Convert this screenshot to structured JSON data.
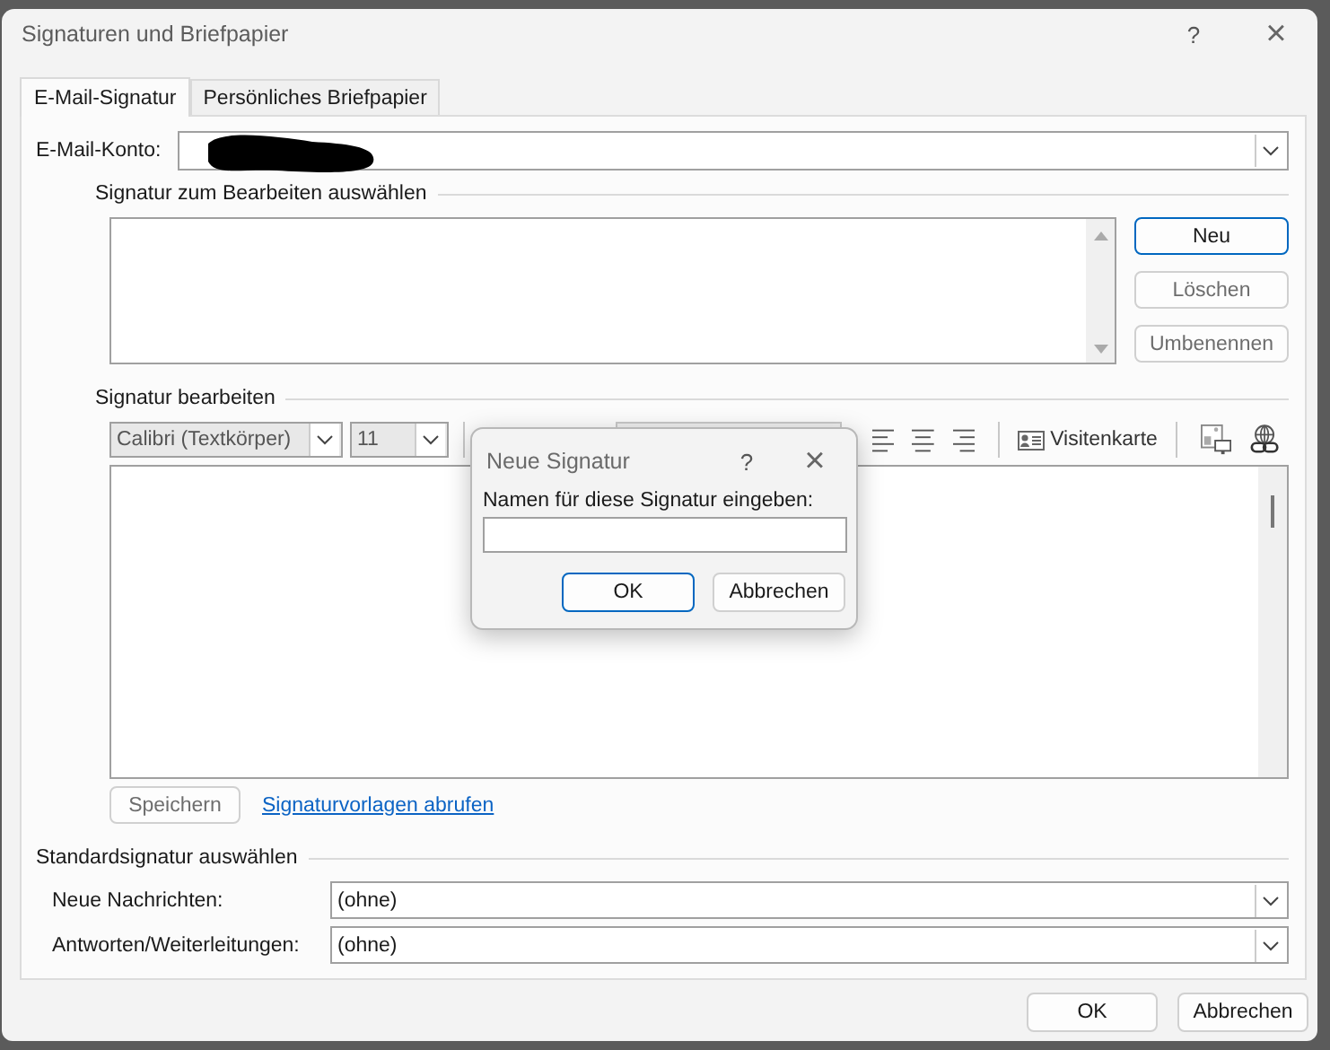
{
  "window": {
    "title": "Signaturen und Briefpapier",
    "help": "?",
    "close": "×"
  },
  "tabs": [
    {
      "label": "E-Mail-Signatur",
      "selected": true
    },
    {
      "label": "Persönliches Briefpapier",
      "selected": false
    }
  ],
  "account": {
    "label": "E-Mail-Konto:"
  },
  "select_group": {
    "title": "Signatur zum Bearbeiten auswählen",
    "buttons": [
      {
        "label": "Neu",
        "default": true,
        "disabled": false
      },
      {
        "label": "Löschen",
        "default": false,
        "disabled": true
      },
      {
        "label": "Umbenennen",
        "default": false,
        "disabled": true
      }
    ]
  },
  "edit_group": {
    "title": "Signatur bearbeiten",
    "font": "Calibri (Textkörper)",
    "size": "11",
    "business_card": "Visitenkarte",
    "save": {
      "label": "Speichern",
      "disabled": true
    },
    "link": "Signaturvorlagen abrufen"
  },
  "default_group": {
    "title": "Standardsignatur auswählen",
    "rows": [
      {
        "label": "Neue Nachrichten:",
        "value": "(ohne)"
      },
      {
        "label": "Antworten/Weiterleitungen:",
        "value": "(ohne)"
      }
    ]
  },
  "buttons": [
    {
      "label": "OK"
    },
    {
      "label": "Abbrechen"
    }
  ],
  "popup": {
    "title": "Neue Signatur",
    "help": "?",
    "close": "×",
    "prompt": "Namen für diese Signatur eingeben:",
    "buttons": [
      {
        "label": "OK",
        "default": true
      },
      {
        "label": "Abbrechen",
        "default": false
      }
    ]
  }
}
